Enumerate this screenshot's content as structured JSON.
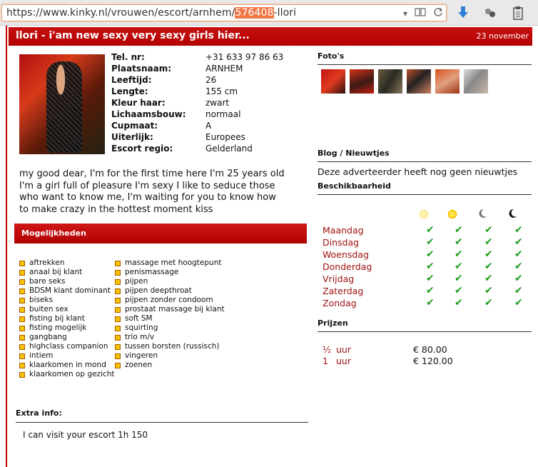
{
  "browser": {
    "url_prefix": "https://www.kinky.nl/vrouwen/escort/arnhem/",
    "url_highlight": "576408",
    "url_suffix": "-llori",
    "icons": [
      "dropdown-icon",
      "reader-icon",
      "reload-icon",
      "download-icon",
      "extensions-icon",
      "clipboard-icon"
    ]
  },
  "ad": {
    "title": "llori - i'am new sexy very sexy girls hier...",
    "date": "23 november"
  },
  "profile": {
    "fields": [
      {
        "label": "Tel. nr:",
        "value": "+31 633 97 86 63"
      },
      {
        "label": "Plaatsnaam:",
        "value": "ARNHEM"
      },
      {
        "label": "Leeftijd:",
        "value": "26"
      },
      {
        "label": "Lengte:",
        "value": "155 cm"
      },
      {
        "label": "Kleur haar:",
        "value": "zwart"
      },
      {
        "label": "Lichaamsbouw:",
        "value": "normaal"
      },
      {
        "label": "Cupmaat:",
        "value": "A"
      },
      {
        "label": "Uiterlijk:",
        "value": "Europees"
      },
      {
        "label": "Escort regio:",
        "value": "Gelderland"
      }
    ],
    "description": "my good dear, I'm for the first time here I'm 25 years old I'm a girl full of pleasure I'm sexy I like to seduce those who want to know me, I'm waiting for you to know how to make crazy in the hottest moment kiss"
  },
  "mogelijkheden": {
    "heading": "Mogelijkheden",
    "col1": [
      "aftrekken",
      "anaal bij klant",
      "bare seks",
      "BDSM klant dominant",
      "biseks",
      "buiten sex",
      "fisting bij klant",
      "fisting mogelijk",
      "gangbang",
      "highclass companion",
      "intiem",
      "klaarkomen in mond",
      "klaarkomen op gezicht"
    ],
    "col2": [
      "massage met hoogtepunt",
      "penismassage",
      "pijpen",
      "pijpen deepthroat",
      "pijpen zonder condoom",
      "prostaat massage bij klant",
      "soft SM",
      "squirting",
      "trio m/v",
      "tussen borsten (russisch)",
      "vingeren",
      "zoenen"
    ]
  },
  "extra": {
    "heading": "Extra info:",
    "text": "I can visit your escort 1h 150"
  },
  "sidebar": {
    "photos_heading": "Foto's",
    "photo_count": 6,
    "blog_heading": "Blog / Nieuwtjes",
    "blog_text": "Deze adverteerder heeft nog geen nieuwtjes",
    "availability_heading": "Beschikbaarheid",
    "period_icons": [
      "morning-sun-icon",
      "afternoon-sun-icon",
      "evening-moon-icon",
      "night-moon-icon"
    ],
    "days": [
      "Maandag",
      "Dinsdag",
      "Woensdag",
      "Donderdag",
      "Vrijdag",
      "Zaterdag",
      "Zondag"
    ],
    "check_glyph": "✔",
    "prices_heading": "Prijzen",
    "prices": [
      {
        "qty": "½",
        "unit": "uur",
        "price": "€ 80.00"
      },
      {
        "qty": "1",
        "unit": "uur",
        "price": "€ 120.00"
      }
    ]
  },
  "colors": {
    "brand_red": "#c00000",
    "day_text": "#a01010",
    "check_green": "#1e9e1e",
    "bullet_yellow": "#f5c300"
  }
}
